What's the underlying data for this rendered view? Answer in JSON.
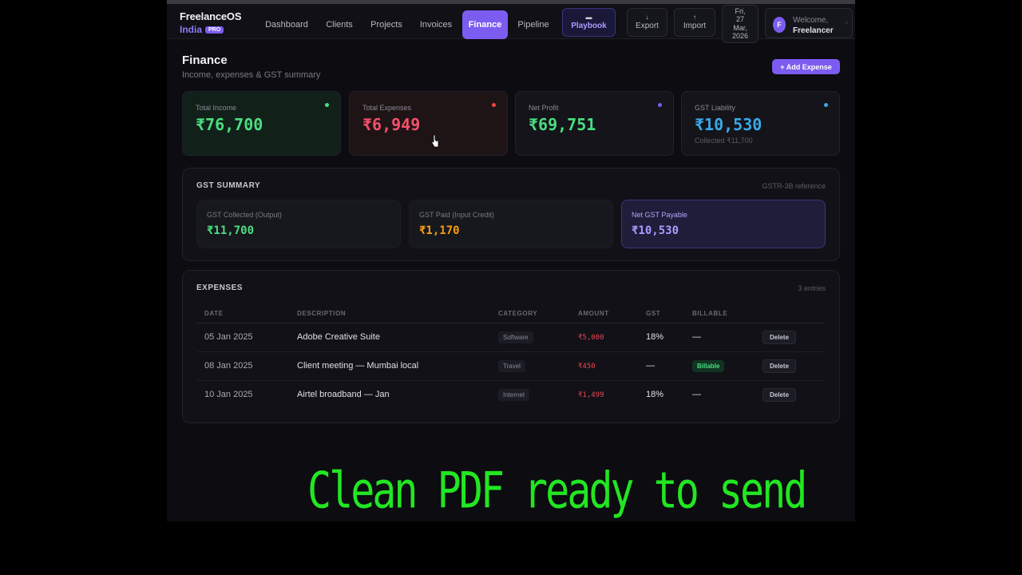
{
  "brand": {
    "name": "FreelanceOS",
    "region": "India",
    "badge": "PRO"
  },
  "nav": {
    "items": [
      "Dashboard",
      "Clients",
      "Projects",
      "Invoices",
      "Finance",
      "Pipeline"
    ],
    "active": "Finance",
    "playbook": {
      "icon": "book-icon",
      "label": "Playbook"
    },
    "export": {
      "icon": "export-icon",
      "label": "Export"
    },
    "import": {
      "icon": "import-icon",
      "label": "Import"
    },
    "date": [
      "Fri,",
      "27",
      "Mar,",
      "2026"
    ],
    "welcome": {
      "avatar": "F",
      "greeting": "Welcome,",
      "user": "Freelancer"
    }
  },
  "page": {
    "title": "Finance",
    "subtitle": "Income, expenses & GST summary",
    "add_button": "+ Add Expense"
  },
  "stats": [
    {
      "label": "Total Income",
      "value": "₹76,700",
      "color": "#4ade80",
      "dot": "#4ade80"
    },
    {
      "label": "Total Expenses",
      "value": "₹6,949",
      "color": "#f4506a",
      "dot": "#ef4444"
    },
    {
      "label": "Net Profit",
      "value": "₹69,751",
      "color": "#4ade80",
      "dot": "#7c5cf0"
    },
    {
      "label": "GST Liability",
      "value": "₹10,530",
      "color": "#3aa8e8",
      "dot": "#3aa8e8",
      "extra": "Collected ₹11,700"
    }
  ],
  "gst": {
    "title": "GST SUMMARY",
    "reference": "GSTR-3B reference",
    "cards": [
      {
        "label": "GST Collected (Output)",
        "value": "₹11,700",
        "color": "#4ade80"
      },
      {
        "label": "GST Paid (Input Credit)",
        "value": "₹1,170",
        "color": "#f59e0b"
      },
      {
        "label": "Net GST Payable",
        "value": "₹10,530",
        "color": "#a89cff"
      }
    ]
  },
  "expenses": {
    "title": "EXPENSES",
    "count": "3 entries",
    "columns": [
      "DATE",
      "DESCRIPTION",
      "CATEGORY",
      "AMOUNT",
      "GST",
      "BILLABLE",
      ""
    ],
    "rows": [
      {
        "date": "05 Jan 2025",
        "description": "Adobe Creative Suite",
        "category": "Software",
        "amount": "₹5,000",
        "gst": "18%",
        "billable": "—",
        "action": "Delete"
      },
      {
        "date": "08 Jan 2025",
        "description": "Client meeting — Mumbai local",
        "category": "Travel",
        "amount": "₹450",
        "gst": "—",
        "billable": "Billable",
        "action": "Delete"
      },
      {
        "date": "10 Jan 2025",
        "description": "Airtel broadband — Jan",
        "category": "Internet",
        "amount": "₹1,499",
        "gst": "18%",
        "billable": "—",
        "action": "Delete"
      }
    ]
  },
  "caption": "Clean PDF ready to send"
}
